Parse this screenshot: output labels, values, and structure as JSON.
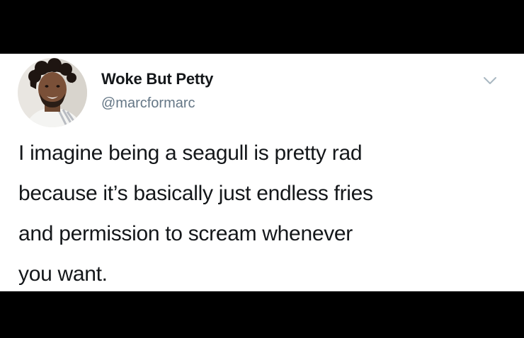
{
  "tweet": {
    "author": {
      "display_name": "Woke But Petty",
      "handle": "@marcformarc",
      "avatar_icon": "user-avatar-photo"
    },
    "menu_icon": "chevron-down-icon",
    "text_lines": [
      "I imagine being a seagull is pretty rad",
      "because it’s basically just endless fries",
      "and permission to scream whenever",
      "you want."
    ]
  },
  "colors": {
    "background": "#000000",
    "card": "#ffffff",
    "text": "#14171a",
    "secondary_text": "#657786",
    "chevron": "#aab8c2"
  }
}
